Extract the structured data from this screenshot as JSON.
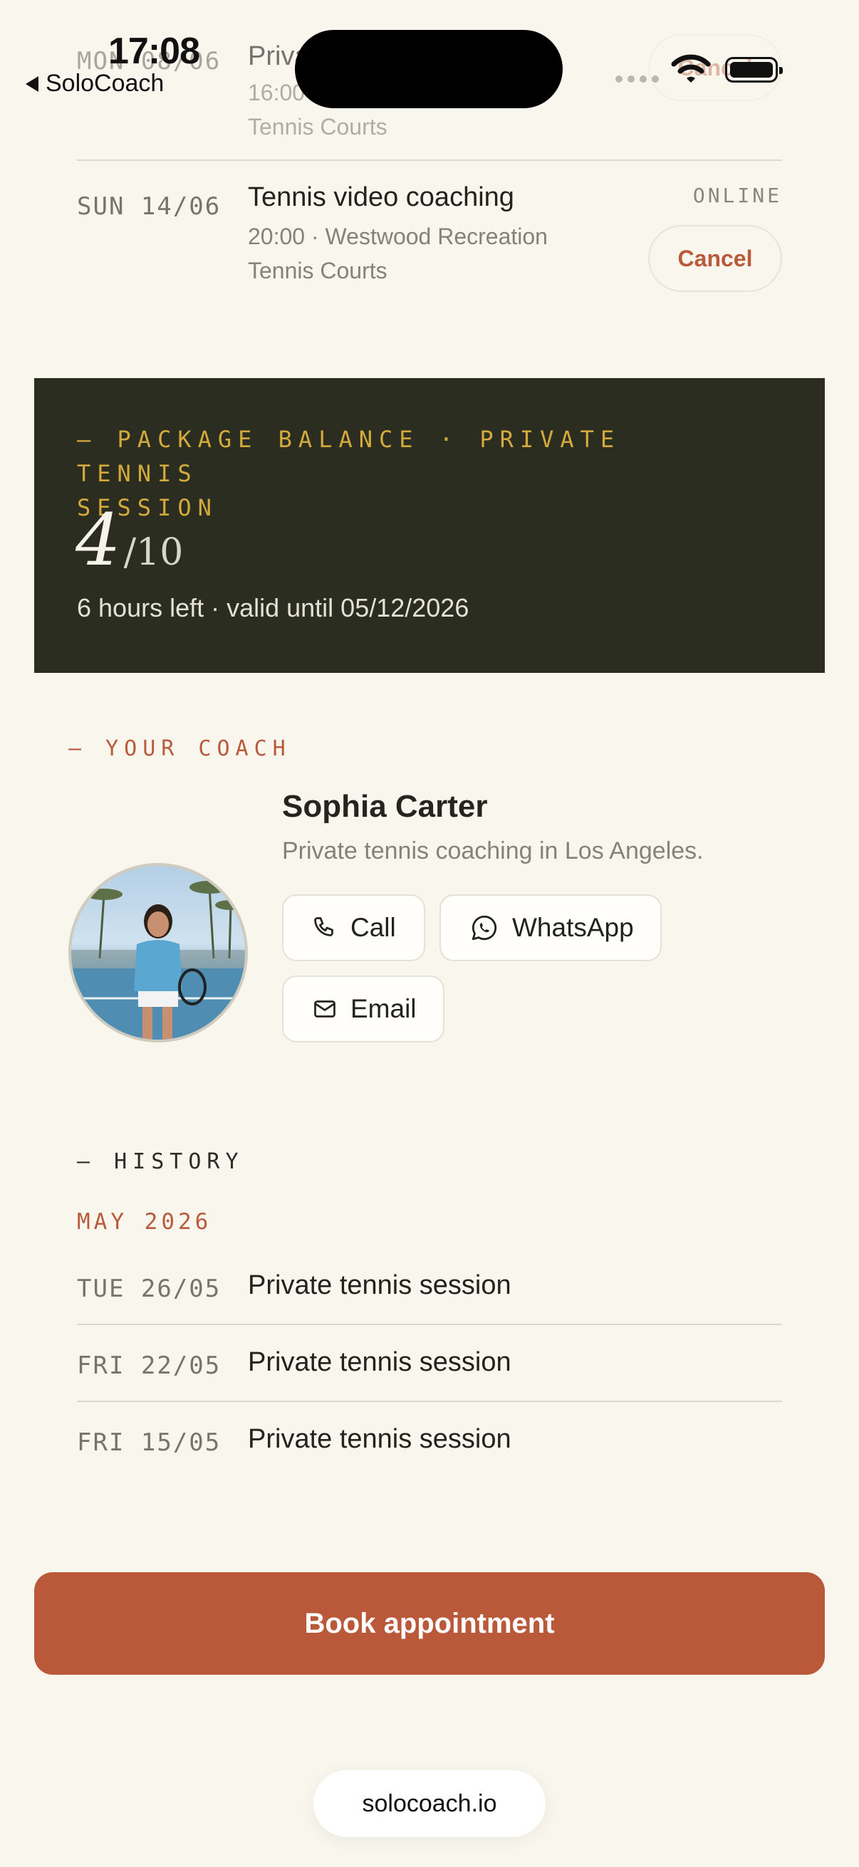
{
  "status_bar": {
    "time": "17:08",
    "back_app": "SoloCoach"
  },
  "upcoming": [
    {
      "date": "MON 08/06",
      "title": "Private tennis session",
      "details": "16:00 · Westwood Recreation",
      "details2": "Tennis Courts",
      "action": "Cancel"
    },
    {
      "date": "SUN 14/06",
      "title": "Tennis video coaching",
      "details": "20:00 · Westwood Recreation",
      "details2": "Tennis Courts",
      "tag": "ONLINE",
      "action": "Cancel"
    }
  ],
  "package": {
    "label_line1": "— PACKAGE BALANCE · PRIVATE TENNIS",
    "label_line2": "SESSION",
    "used": "4",
    "total": "/10",
    "remaining": 0.4,
    "note": "6 hours left · valid until 05/12/2026"
  },
  "coach": {
    "section_label": "— YOUR COACH",
    "name": "Sophia Carter",
    "description": "Private tennis coaching in Los Angeles.",
    "actions": {
      "call": "Call",
      "whatsapp": "WhatsApp",
      "email": "Email"
    }
  },
  "history": {
    "section_label": "— HISTORY",
    "month": "MAY 2026",
    "items": [
      {
        "date": "TUE 26/05",
        "title": "Private tennis session"
      },
      {
        "date": "FRI 22/05",
        "title": "Private tennis session"
      },
      {
        "date": "FRI 15/05",
        "title": "Private tennis session"
      }
    ]
  },
  "book_button": "Book appointment",
  "url": "solocoach.io",
  "colors": {
    "background": "#f9f6ee",
    "accent": "#b9593a",
    "card_dark": "#2b2d20",
    "gold": "#d4aa3c"
  }
}
